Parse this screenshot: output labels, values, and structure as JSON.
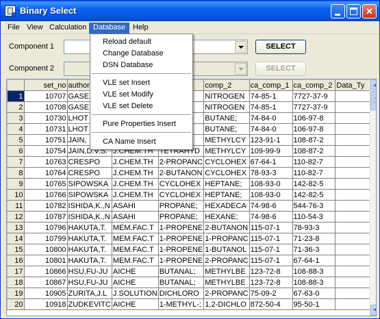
{
  "window": {
    "title": "Binary Select",
    "controls": {
      "minimize": "",
      "maximize": "",
      "close": "✕"
    }
  },
  "menubar": {
    "items": [
      "File",
      "View",
      "Calculation",
      "Database",
      "Help"
    ],
    "active": "Database"
  },
  "database_menu": {
    "groups": [
      [
        "Reload default",
        "Change Database",
        "DSN Database"
      ],
      [
        "VLE set Insert",
        "VLE set Modify",
        "VLE set Delete"
      ],
      [
        "Pure Properties Insert"
      ],
      [
        "CA Name Insert"
      ]
    ]
  },
  "form": {
    "component1": {
      "label": "Component 1",
      "value": "",
      "button": "SELECT"
    },
    "component2": {
      "label": "Component 2",
      "value": "",
      "button": "SELECT"
    }
  },
  "grid": {
    "columns": [
      "set_no",
      "author",
      "",
      "",
      "comp_2",
      "ca_comp_1",
      "ca_comp_2",
      "Data_Ty"
    ],
    "rows": [
      {
        "n": "1",
        "set_no": "10707",
        "author": "GASE",
        "journal": "",
        "comp_1": "",
        "comp_2": "NITROGEN",
        "ca1": "74-85-1",
        "ca2": "7727-37-9",
        "dt": ""
      },
      {
        "n": "2",
        "set_no": "10708",
        "author": "GASE",
        "journal": "",
        "comp_1": "",
        "comp_2": "NITROGEN",
        "ca1": "74-85-1",
        "ca2": "7727-37-9",
        "dt": ""
      },
      {
        "n": "3",
        "set_no": "10730",
        "author": "LHOT",
        "journal": "",
        "comp_1": "",
        "comp_2": "BUTANE;",
        "ca1": "74-84-0",
        "ca2": "106-97-8",
        "dt": ""
      },
      {
        "n": "4",
        "set_no": "10731",
        "author": "LHOT",
        "journal": "",
        "comp_1": "",
        "comp_2": "BUTANE;",
        "ca1": "74-84-0",
        "ca2": "106-97-8",
        "dt": ""
      },
      {
        "n": "5",
        "set_no": "10751",
        "author": "JAIN,",
        "journal": "",
        "comp_1": "",
        "comp_2": "METHYLCY",
        "ca1": "123-91-1",
        "ca2": "108-87-2",
        "dt": ""
      },
      {
        "n": "6",
        "set_no": "10754",
        "author": "JAIN,D.V.S.",
        "journal": "J.CHEM.TH",
        "comp_1": "TETRAHYD",
        "comp_2": "METHYLCY",
        "ca1": "109-99-9",
        "ca2": "108-87-2",
        "dt": ""
      },
      {
        "n": "7",
        "set_no": "10763",
        "author": "CRESPO",
        "journal": "J.CHEM.TH",
        "comp_1": "2-PROPANC",
        "comp_2": "CYCLOHEX",
        "ca1": "67-64-1",
        "ca2": "110-82-7",
        "dt": ""
      },
      {
        "n": "8",
        "set_no": "10764",
        "author": "CRESPO",
        "journal": "J.CHEM.TH",
        "comp_1": "2-BUTANON",
        "comp_2": "CYCLOHEX",
        "ca1": "78-93-3",
        "ca2": "110-82-7",
        "dt": ""
      },
      {
        "n": "9",
        "set_no": "10765",
        "author": "SIPOWSKA",
        "journal": "J.CHEM.TH",
        "comp_1": "CYCLOHEX",
        "comp_2": "HEPTANE;",
        "ca1": "108-93-0",
        "ca2": "142-82-5",
        "dt": ""
      },
      {
        "n": "10",
        "set_no": "10766",
        "author": "SIPOWSKA",
        "journal": "J.CHEM.TH",
        "comp_1": "CYCLOHEX",
        "comp_2": "HEPTANE;",
        "ca1": "108-93-0",
        "ca2": "142-82-5",
        "dt": ""
      },
      {
        "n": "11",
        "set_no": "10782",
        "author": "ISHIDA,K.,N",
        "journal": "ASAHI",
        "comp_1": "PROPANE;",
        "comp_2": "HEXADECA",
        "ca1": "74-98-6",
        "ca2": "544-76-3",
        "dt": ""
      },
      {
        "n": "12",
        "set_no": "10787",
        "author": "ISHIDA,K.,N",
        "journal": "ASAHI",
        "comp_1": "PROPANE;",
        "comp_2": "HEXANE;",
        "ca1": "74-98-6",
        "ca2": "110-54-3",
        "dt": ""
      },
      {
        "n": "13",
        "set_no": "10796",
        "author": "HAKUTA,T.",
        "journal": "MEM.FAC.T",
        "comp_1": "1-PROPENE",
        "comp_2": "2-BUTANON",
        "ca1": "115-07-1",
        "ca2": "78-93-3",
        "dt": ""
      },
      {
        "n": "14",
        "set_no": "10799",
        "author": "HAKUTA,T.",
        "journal": "MEM.FAC.T",
        "comp_1": "1-PROPENE",
        "comp_2": "1-PROPANC",
        "ca1": "115-07-1",
        "ca2": "71-23-8",
        "dt": ""
      },
      {
        "n": "15",
        "set_no": "10800",
        "author": "HAKUTA,T.",
        "journal": "MEM.FAC.T",
        "comp_1": "1-PROPENE",
        "comp_2": "1-BUTANOL",
        "ca1": "115-07-1",
        "ca2": "71-36-3",
        "dt": ""
      },
      {
        "n": "16",
        "set_no": "10801",
        "author": "HAKUTA,T.",
        "journal": "MEM.FAC.T",
        "comp_1": "1-PROPENE",
        "comp_2": "2-PROPANC",
        "ca1": "115-07-1",
        "ca2": "67-64-1",
        "dt": ""
      },
      {
        "n": "17",
        "set_no": "10866",
        "author": "HSU,FU-JU",
        "journal": "AICHE",
        "comp_1": "BUTANAL;",
        "comp_2": "METHYLBE",
        "ca1": "123-72-8",
        "ca2": "108-88-3",
        "dt": ""
      },
      {
        "n": "18",
        "set_no": "10867",
        "author": "HSU,FU-JU",
        "journal": "AICHE",
        "comp_1": "BUTANAL;",
        "comp_2": "METHYLBE",
        "ca1": "123-72-8",
        "ca2": "108-88-3",
        "dt": ""
      },
      {
        "n": "19",
        "set_no": "10905",
        "author": "ZURITA,J.L",
        "journal": "J.SOLUTION",
        "comp_1": "DICHLORO",
        "comp_2": "2-PROPANC",
        "ca1": "75-09-2",
        "ca2": "67-63-0",
        "dt": ""
      },
      {
        "n": "20",
        "set_no": "10918",
        "author": "ZUDKEVITC",
        "journal": "AICHE",
        "comp_1": "1-METHYL-;",
        "comp_2": "1,2-DICHLO",
        "ca1": "872-50-4",
        "ca2": "95-50-1",
        "dt": ""
      }
    ]
  }
}
